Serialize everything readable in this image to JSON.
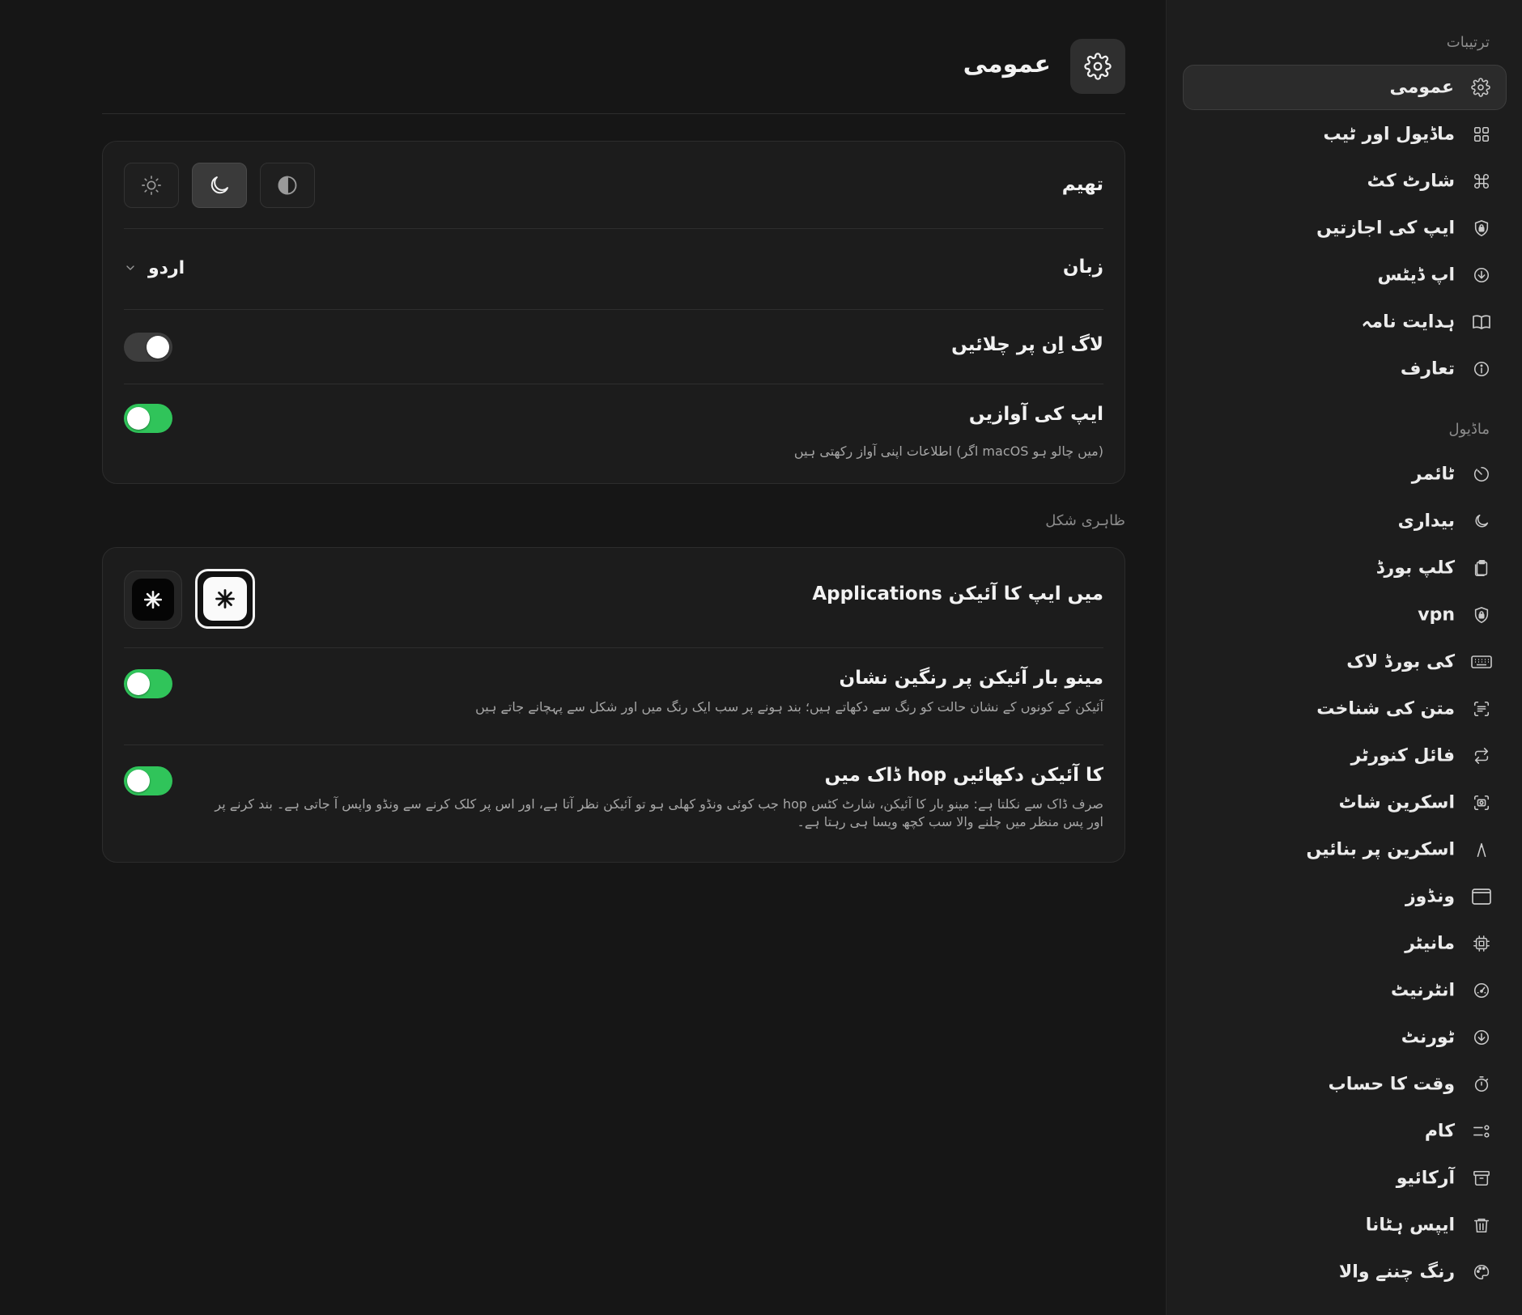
{
  "header": {
    "title": "عمومی",
    "icon": "gear-icon"
  },
  "general_card": {
    "theme": {
      "label": "تھیم",
      "options": [
        "contrast-icon",
        "moon-icon",
        "sun-icon"
      ],
      "selected": "moon-icon"
    },
    "language": {
      "label": "زبان",
      "value": "اردو"
    },
    "launch_at_login": {
      "label": "لاگ اِن پر چلائیں",
      "enabled": false
    },
    "app_sounds": {
      "label": "ایپ کی آوازیں",
      "description": "اطلاعات اپنی آواز رکھتی ہیں (اگر macOS میں چالو ہو)",
      "enabled": true
    }
  },
  "appearance_section": {
    "label": "ظاہری شکل"
  },
  "appearance_card": {
    "app_icon": {
      "label": "Applications میں ایپ کا آئیکن",
      "options": [
        "light-app-icon",
        "dark-app-icon"
      ],
      "selected": "light-app-icon"
    },
    "colored_menubar": {
      "label": "مینو بار آئیکن پر رنگین نشان",
      "description": "آئیکن کے کونوں کے نشان حالت کو رنگ سے دکھاتے ہیں؛ بند ہونے پر سب ایک رنگ میں اور شکل سے پہچانے جاتے ہیں",
      "enabled": true
    },
    "dock_icon": {
      "label": "ڈاک میں hop کا آئیکن دکھائیں",
      "description_line1": "جب کوئی ونڈو کھلی ہو تو آئیکن نظر آتا ہے، اور اس پر کلک کرنے سے ونڈو واپس آ جاتی ہے۔ بند کرنے پر hop صرف ڈاک سے نکلتا ہے: مینو بار کا آئیکن، شارٹ کٹس",
      "description_line2": "اور پس منظر میں چلنے والا سب کچھ ویسا ہی رہتا ہے۔",
      "enabled": true
    }
  },
  "sidebar": {
    "settings_heading": "ترتیبات",
    "settings_items": [
      {
        "label": "عمومی",
        "icon": "gear-icon",
        "active": true
      },
      {
        "label": "ماڈیول اور ٹیب",
        "icon": "grid-icon"
      },
      {
        "label": "شارٹ کٹ",
        "icon": "command-icon"
      },
      {
        "label": "ایپ کی اجازتیں",
        "icon": "shield-lock-icon"
      },
      {
        "label": "اپ ڈیٹس",
        "icon": "download-circle-icon"
      },
      {
        "label": "ہدایت نامہ",
        "icon": "book-icon"
      },
      {
        "label": "تعارف",
        "icon": "info-icon"
      }
    ],
    "modules_heading": "ماڈیول",
    "module_items": [
      {
        "label": "ٹائمر",
        "icon": "timer-icon"
      },
      {
        "label": "بیداری",
        "icon": "moon-icon"
      },
      {
        "label": "کلپ بورڈ",
        "icon": "clipboard-icon"
      },
      {
        "label": "vpn",
        "icon": "shield-lock-icon"
      },
      {
        "label": "کی بورڈ لاک",
        "icon": "keyboard-icon"
      },
      {
        "label": "متن کی شناخت",
        "icon": "text-scan-icon"
      },
      {
        "label": "فائل کنورٹر",
        "icon": "convert-icon"
      },
      {
        "label": "اسکرین شاٹ",
        "icon": "camera-icon"
      },
      {
        "label": "اسکرین پر بنائیں",
        "icon": "pen-icon"
      },
      {
        "label": "ونڈوز",
        "icon": "window-icon"
      },
      {
        "label": "مانیٹر",
        "icon": "chip-icon"
      },
      {
        "label": "انٹرنیٹ",
        "icon": "speedometer-icon"
      },
      {
        "label": "ٹورنٹ",
        "icon": "download-circle-icon"
      },
      {
        "label": "وقت کا حساب",
        "icon": "stopwatch-icon"
      },
      {
        "label": "کام",
        "icon": "tasks-icon"
      },
      {
        "label": "آرکائیو",
        "icon": "archive-icon"
      },
      {
        "label": "ایپس ہٹانا",
        "icon": "trash-icon"
      },
      {
        "label": "رنگ چننے والا",
        "icon": "palette-icon"
      }
    ]
  },
  "colors": {
    "toggle_on": "#30c45a",
    "toggle_off": "#3d3d3d",
    "background": "#161616",
    "sidebar": "#1d1d1d",
    "card": "#1c1c1c"
  }
}
